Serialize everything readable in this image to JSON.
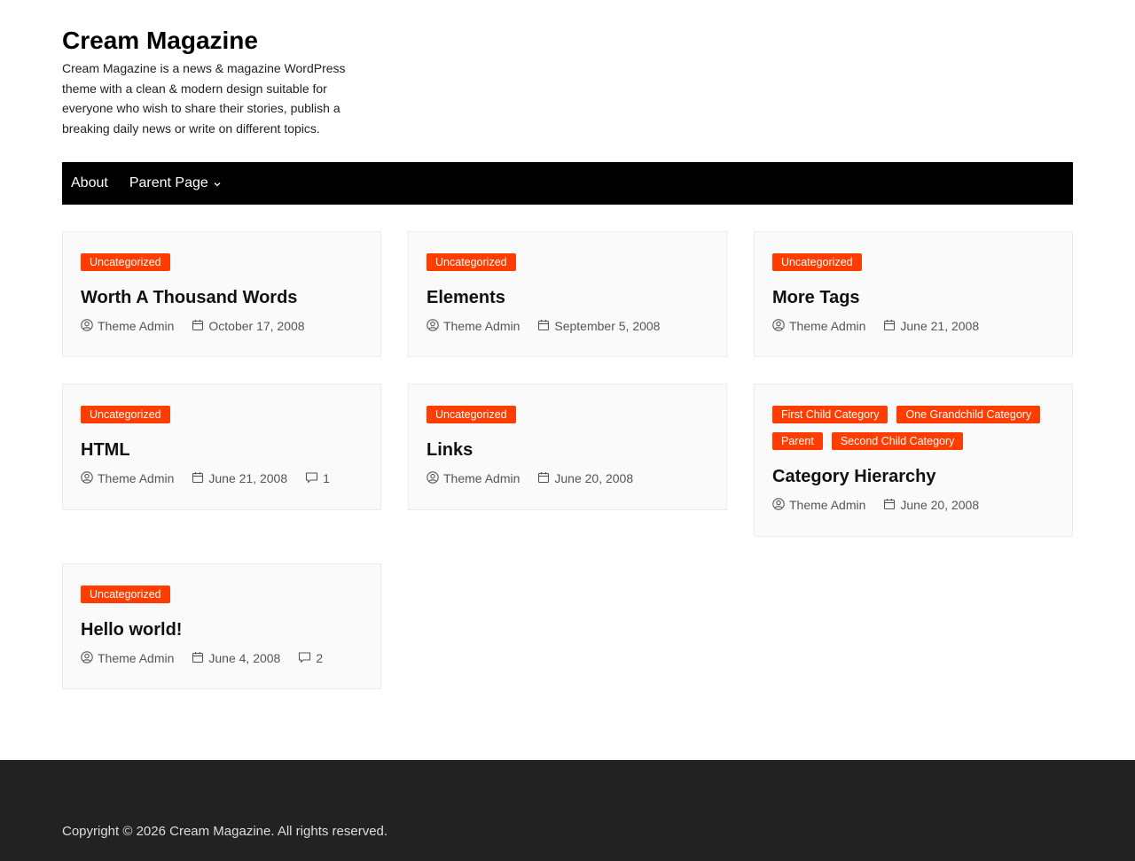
{
  "site": {
    "title": "Cream Magazine",
    "description": "Cream Magazine is a news & magazine WordPress theme with a clean & modern design suitable for everyone who wish to share their stories, publish a breaking daily news or write on different topics."
  },
  "nav": {
    "items": [
      {
        "label": "About"
      },
      {
        "label": "Parent Page"
      }
    ]
  },
  "posts": [
    {
      "categories": [
        "Uncategorized"
      ],
      "title": "Worth A Thousand Words",
      "author": "Theme Admin",
      "date": "October 17, 2008",
      "comments": ""
    },
    {
      "categories": [
        "Uncategorized"
      ],
      "title": "Elements",
      "author": "Theme Admin",
      "date": "September 5, 2008",
      "comments": ""
    },
    {
      "categories": [
        "Uncategorized"
      ],
      "title": "More Tags",
      "author": "Theme Admin",
      "date": "June 21, 2008",
      "comments": ""
    },
    {
      "categories": [
        "Uncategorized"
      ],
      "title": "HTML",
      "author": "Theme Admin",
      "date": "June 21, 2008",
      "comments": "1"
    },
    {
      "categories": [
        "Uncategorized"
      ],
      "title": "Links",
      "author": "Theme Admin",
      "date": "June 20, 2008",
      "comments": ""
    },
    {
      "categories": [
        "First Child Category",
        "One Grandchild Category",
        "Parent",
        "Second Child Category"
      ],
      "title": "Category Hierarchy",
      "author": "Theme Admin",
      "date": "June 20, 2008",
      "comments": ""
    },
    {
      "categories": [
        "Uncategorized"
      ],
      "title": "Hello world!",
      "author": "Theme Admin",
      "date": "June 4, 2008",
      "comments": "2"
    }
  ],
  "footer": {
    "copyright": "Copyright © 2026 Cream Magazine. All rights reserved."
  },
  "colors": {
    "accent": "#ff3d00",
    "nav_bg": "#000000",
    "footer_bg": "#222222"
  },
  "icons": {
    "author": "user-icon",
    "date": "calendar-icon",
    "comments": "comment-icon",
    "submenu": "chevron-down-icon"
  }
}
